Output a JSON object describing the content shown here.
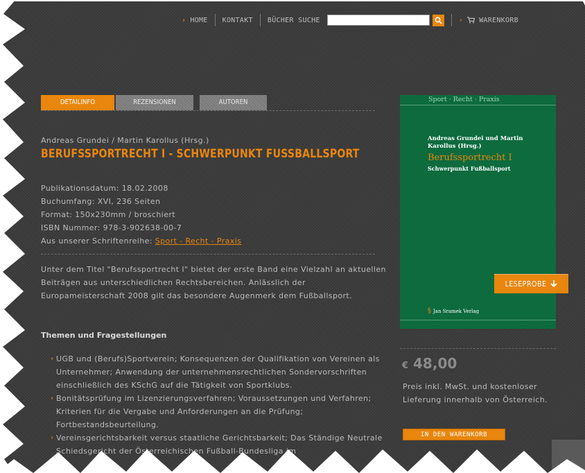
{
  "nav": {
    "home": "HOME",
    "contact": "KONTAKT",
    "book_search": "BÜCHER SUCHE",
    "search_placeholder": "",
    "cart": "WARENKORB"
  },
  "tabs": [
    {
      "label": "DETAILINFO",
      "active": true
    },
    {
      "label": "REZENSIONEN",
      "active": false
    },
    {
      "label": "AUTOREN",
      "active": false
    }
  ],
  "book": {
    "authors": "Andreas Grundei / Martin Karollus (Hrsg.)",
    "title": "BERUFSSPORTRECHT I - SCHWERPUNKT FUSSBALLSPORT",
    "meta": {
      "pub_date": "Publikationsdatum: 18.02.2008",
      "extent": "Buchumfang: XVI, 236 Seiten",
      "format": "Format: 150x230mm / broschiert",
      "isbn": "ISBN Nummer: 978-3-902638-00-7",
      "series_prefix": "Aus unserer Schriftenreihe: ",
      "series_link": "Sport - Recht - Praxis"
    },
    "intro": "Unter dem Titel \"Berufssportrecht I\" bietet der erste Band eine Vielzahl an aktuellen Beiträgen aus unterschiedlichen Rechtsbereichen. Anlässlich der Europameisterschaft 2008 gilt das besondere Augenmerk dem Fußballsport.",
    "themes_heading": "Themen und Fragestellungen",
    "themes": [
      "UGB und (Berufs)Sportverein; Konsequenzen der Qualifikation von Vereinen als Unternehmer; Anwendung der unternehmensrechtlichen Sondervorschriften einschließlich des KSchG auf die Tätigkeit von Sportklubs.",
      "Bonitätsprüfung im Lizenzierungsverfahren; Voraussetzungen und Verfahren; Kriterien für die Vergabe und Anforderungen an die Prüfung; Fortbestandsbeurteilung.",
      "Vereinsgerichtsbarkeit versus staatliche Gerichtsbarkeit; Das Ständige Neutrale Schiedsgericht der Österreichischen Fußball-Bundesliga im"
    ]
  },
  "cover": {
    "series": "Sport · Recht · Praxis",
    "authors": "Andreas Grundei und Martin Karollus (Hrsg.)",
    "title": "Berufssportrecht I",
    "subtitle": "Schwerpunkt Fußballsport",
    "publisher": "Jan Sramek Verlag"
  },
  "leseprobe": "LESEPROBE",
  "price": {
    "currency": "€",
    "amount": "48,00",
    "note": "Preis inkl. MwSt. und kostenloser Lieferung innerhalb von Österreich.",
    "button": "IN DEN WARENKORB"
  },
  "colors": {
    "accent": "#e8860e",
    "background": "#3b3b3b",
    "cover": "#0d6b3e"
  }
}
